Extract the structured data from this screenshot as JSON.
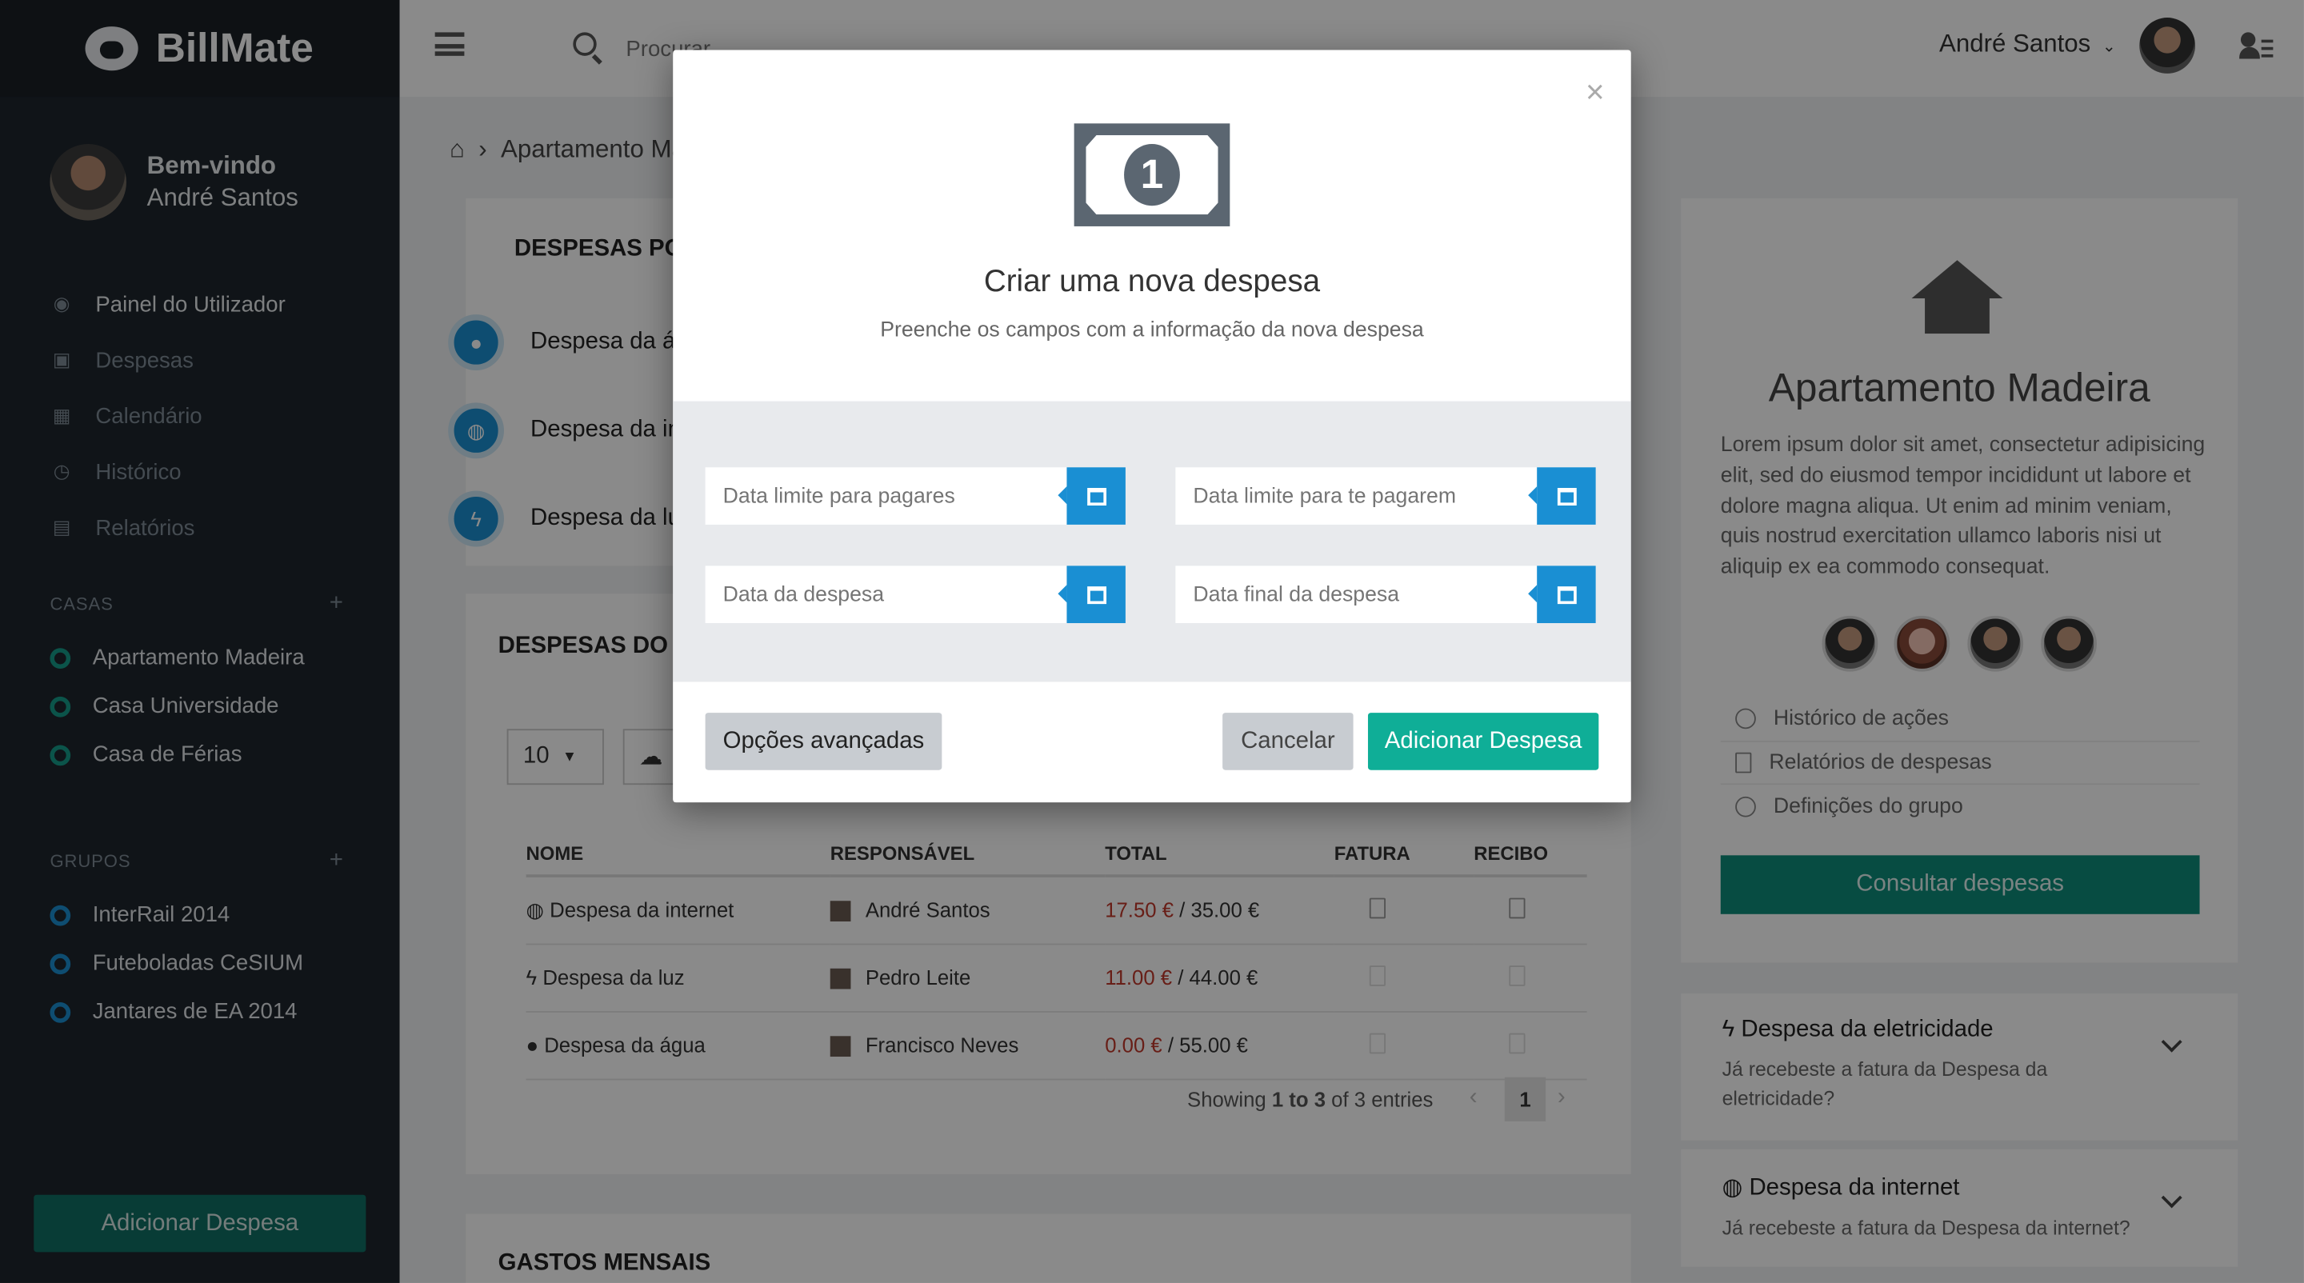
{
  "app": {
    "name": "BillMate"
  },
  "sidebar": {
    "welcome": "Bem-vindo",
    "user_name": "André Santos",
    "nav": [
      {
        "label": "Painel do Utilizador",
        "icon": "dashboard-icon"
      },
      {
        "label": "Despesas",
        "icon": "money-icon"
      },
      {
        "label": "Calendário",
        "icon": "calendar-icon"
      },
      {
        "label": "Histórico",
        "icon": "clock-icon"
      },
      {
        "label": "Relatórios",
        "icon": "file-icon"
      }
    ],
    "casas_title": "CASAS",
    "casas": [
      "Apartamento Madeira",
      "Casa Universidade",
      "Casa de Férias"
    ],
    "grupos_title": "GRUPOS",
    "grupos": [
      "InterRail 2014",
      "Futeboladas CeSIUM",
      "Jantares de EA 2014"
    ],
    "add_button": "Adicionar Despesa"
  },
  "topbar": {
    "search_placeholder": "Procurar",
    "user": "André Santos"
  },
  "breadcrumb": {
    "current": "Apartamento Madeira"
  },
  "main": {
    "section1_title": "DESPESAS POR PAGAR",
    "pending": [
      "Despesa da água",
      "Despesa da internet",
      "Despesa da luz"
    ],
    "section2_title": "DESPESAS DO GRUPO",
    "page_size": "10",
    "table": {
      "headers": [
        "NOME",
        "RESPONSÁVEL",
        "TOTAL",
        "FATURA",
        "RECIBO"
      ],
      "rows": [
        {
          "name": "Despesa da internet",
          "responsible": "André Santos",
          "paid": "17.50 €",
          "total": "/ 35.00 €"
        },
        {
          "name": "Despesa da luz",
          "responsible": "Pedro Leite",
          "paid": "11.00 €",
          "total": "/ 44.00 €"
        },
        {
          "name": "Despesa da água",
          "responsible": "Francisco Neves",
          "paid": "0.00 €",
          "total": "/ 55.00 €"
        }
      ]
    },
    "pagination": {
      "showing": "Showing",
      "range": "1 to 3",
      "of": "of 3 entries",
      "page": "1"
    },
    "section3_title": "GASTOS MENSAIS"
  },
  "right": {
    "title": "Apartamento Madeira",
    "description": "Lorem ipsum dolor sit amet, consectetur adipisicing elit, sed do eiusmod tempor incididunt ut labore et dolore magna aliqua. Ut enim ad minim veniam, quis nostrud exercitation ullamco laboris nisi ut aliquip ex ea commodo consequat.",
    "links": [
      "Histórico de ações",
      "Relatórios de despesas",
      "Definições do grupo"
    ],
    "consult": "Consultar despesas",
    "acc1_title": "Despesa da eletricidade",
    "acc1_text": "Já recebeste a fatura da Despesa da eletricidade?",
    "acc2_title": "Despesa da internet",
    "acc2_text": "Já recebeste a fatura da Despesa da internet?"
  },
  "modal": {
    "title": "Criar uma nova despesa",
    "subtitle": "Preenche os campos com a informação da nova despesa",
    "fields": [
      "Data limite para pagares",
      "Data limite para te pagarem",
      "Data da despesa",
      "Data final da despesa"
    ],
    "advanced": "Opções avançadas",
    "cancel": "Cancelar",
    "submit": "Adicionar Despesa",
    "coin": "1",
    "close": "×"
  },
  "colors": {
    "accent": "#0fae97",
    "blue": "#1a8fd3",
    "sidebar": "#1f262d",
    "money": "#c0392b"
  }
}
